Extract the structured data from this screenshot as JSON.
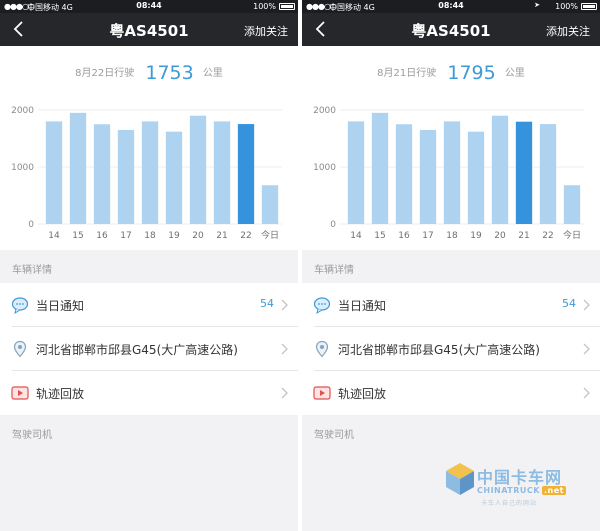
{
  "screens": [
    {
      "status": {
        "signal": "●●●○○",
        "carrier": "中国移动",
        "network": "4G",
        "time": "08:44",
        "location": "",
        "battery": "100%"
      },
      "nav": {
        "back_icon": "chevron-left-icon",
        "title": "粤AS4501",
        "action": "添加关注"
      },
      "summary": {
        "date_label": "8月22日行驶",
        "value": "1753",
        "unit": "公里"
      },
      "chart_data": {
        "type": "bar",
        "categories": [
          "14",
          "15",
          "16",
          "17",
          "18",
          "19",
          "20",
          "21",
          "22",
          "今日"
        ],
        "values": [
          1800,
          1950,
          1750,
          1650,
          1800,
          1620,
          1900,
          1800,
          1753,
          680
        ],
        "highlight": "22",
        "yticks": [
          0,
          1000,
          2000
        ],
        "ylim": [
          0,
          2000
        ],
        "colors": {
          "bar": "#aed3f0",
          "highlight": "#3592dc"
        }
      },
      "section_detail": "车辆详情",
      "rows": [
        {
          "icon": "chat-bubble-icon",
          "label": "当日通知",
          "count": "54"
        },
        {
          "icon": "location-pin-icon",
          "label": "河北省邯郸市邱县G45(大广高速公路)",
          "count": ""
        },
        {
          "icon": "play-icon",
          "label": "轨迹回放",
          "count": ""
        }
      ],
      "section_driver": "驾驶司机"
    },
    {
      "status": {
        "signal": "●●●○○",
        "carrier": "中国移动",
        "network": "4G",
        "time": "08:44",
        "location": "➤",
        "battery": "100%"
      },
      "nav": {
        "back_icon": "chevron-left-icon",
        "title": "粤AS4501",
        "action": "添加关注"
      },
      "summary": {
        "date_label": "8月21日行驶",
        "value": "1795",
        "unit": "公里"
      },
      "chart_data": {
        "type": "bar",
        "categories": [
          "14",
          "15",
          "16",
          "17",
          "18",
          "19",
          "20",
          "21",
          "22",
          "今日"
        ],
        "values": [
          1800,
          1950,
          1750,
          1650,
          1800,
          1620,
          1900,
          1795,
          1753,
          680
        ],
        "highlight": "21",
        "yticks": [
          0,
          1000,
          2000
        ],
        "ylim": [
          0,
          2000
        ],
        "colors": {
          "bar": "#aed3f0",
          "highlight": "#3592dc"
        }
      },
      "section_detail": "车辆详情",
      "rows": [
        {
          "icon": "chat-bubble-icon",
          "label": "当日通知",
          "count": "54"
        },
        {
          "icon": "location-pin-icon",
          "label": "河北省邯郸市邱县G45(大广高速公路)",
          "count": ""
        },
        {
          "icon": "play-icon",
          "label": "轨迹回放",
          "count": ""
        }
      ],
      "section_driver": "驾驶司机"
    }
  ],
  "watermark": {
    "name": "中国卡车网",
    "latin": "CHINATRUCK",
    "suffix": ".net",
    "slogan": "卡车人自己的网站"
  }
}
